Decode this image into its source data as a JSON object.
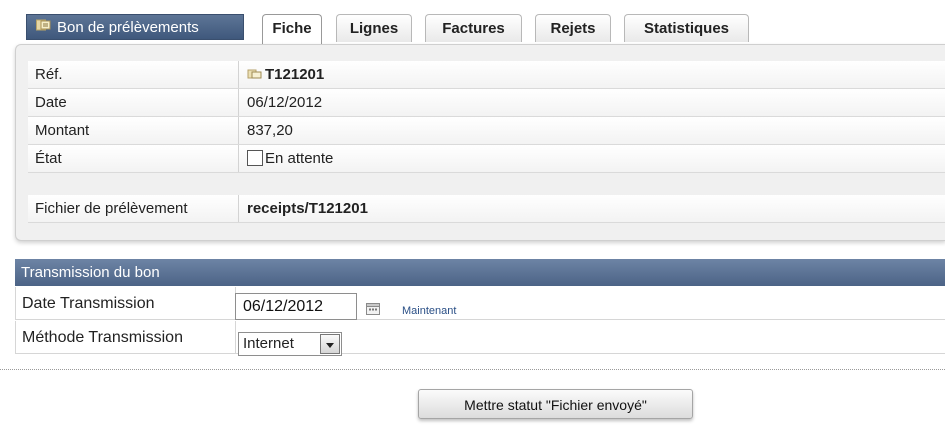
{
  "tabs": {
    "title": "Bon de prélèvements",
    "items": [
      {
        "label": "Fiche",
        "active": true
      },
      {
        "label": "Lignes",
        "active": false
      },
      {
        "label": "Factures",
        "active": false
      },
      {
        "label": "Rejets",
        "active": false
      },
      {
        "label": "Statistiques",
        "active": false
      }
    ]
  },
  "fiche": {
    "ref_label": "Réf.",
    "ref_value": "T121201",
    "date_label": "Date",
    "date_value": "06/12/2012",
    "montant_label": "Montant",
    "montant_value": "837,20",
    "etat_label": "État",
    "etat_value": "En attente",
    "fichier_label": "Fichier de prélèvement",
    "fichier_value": "receipts/T121201"
  },
  "transmission": {
    "header": "Transmission du bon",
    "date_label": "Date Transmission",
    "date_value": "06/12/2012",
    "now_link": "Maintenant",
    "method_label": "Méthode Transmission",
    "method_value": "Internet"
  },
  "actions": {
    "set_status": "Mettre statut \"Fichier envoyé\""
  },
  "colors": {
    "header_blue": "#4c6386",
    "link_blue": "#2a4f86"
  }
}
